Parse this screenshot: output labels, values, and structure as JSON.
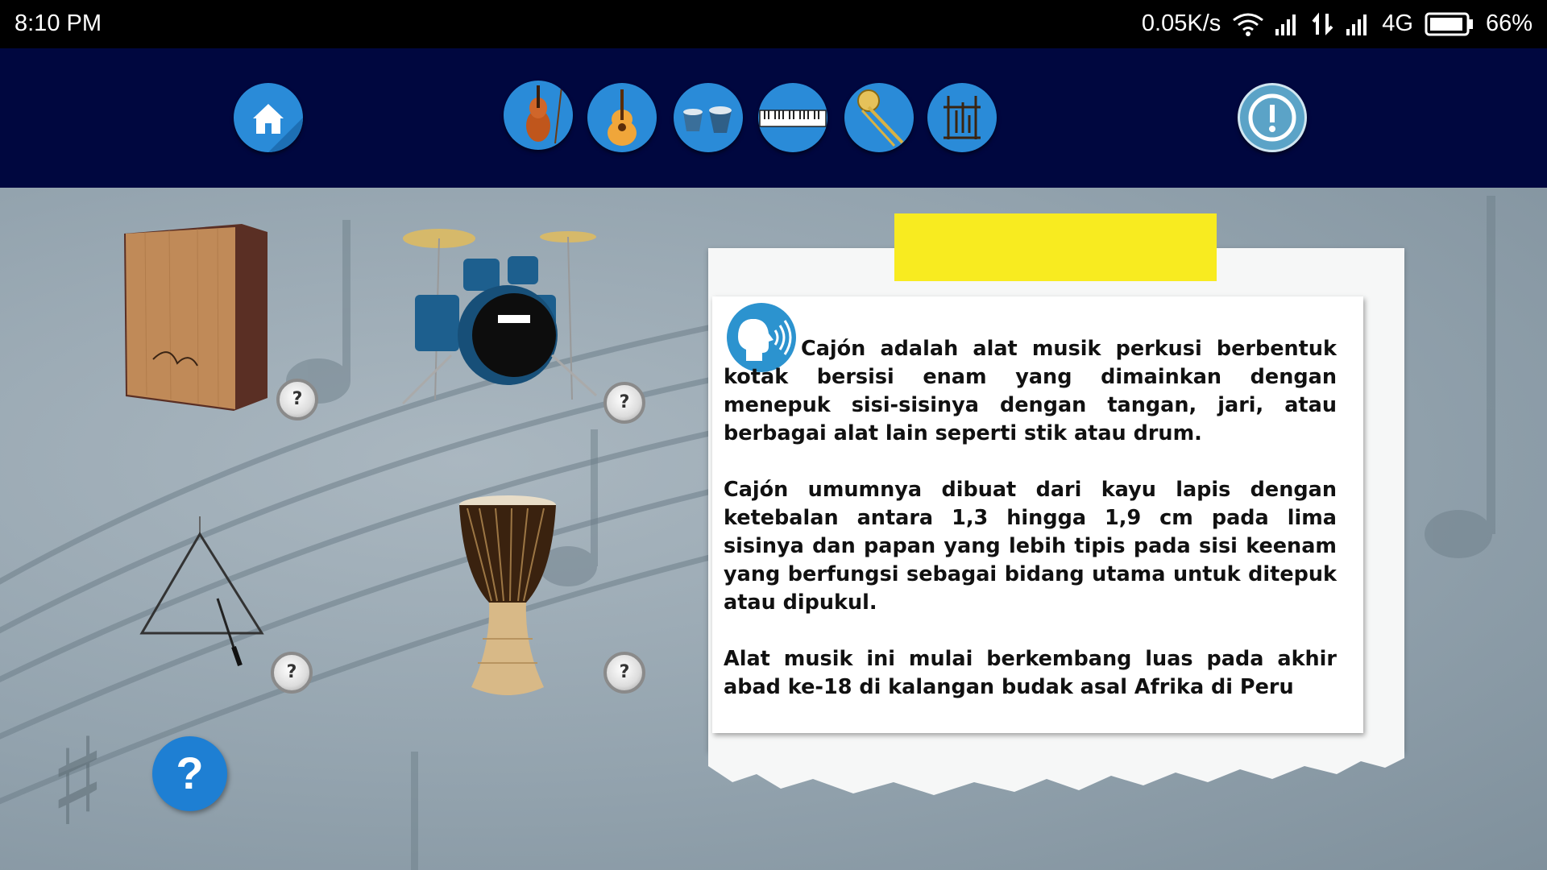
{
  "status_bar": {
    "time": "8:10 PM",
    "net_speed": "0.05K/s",
    "network_type": "4G",
    "battery_percent": "66%",
    "icons": [
      "wifi-icon",
      "signal-icon",
      "data-transfer-icon",
      "signal-icon",
      "battery-icon"
    ]
  },
  "nav": {
    "home_icon": "home-icon",
    "instrument_icons": [
      "violin-icon",
      "guitar-icon",
      "bongo-icon",
      "keyboard-icon",
      "trombone-icon",
      "angklung-icon"
    ],
    "info_icon": "info-icon"
  },
  "instruments": [
    {
      "name": "cajon",
      "help_label": "?"
    },
    {
      "name": "drum-kit",
      "help_label": "?"
    },
    {
      "name": "triangle",
      "help_label": "?"
    },
    {
      "name": "djembe",
      "help_label": "?"
    }
  ],
  "help_button_label": "?",
  "info_card": {
    "audio_icon": "speaker-icon",
    "paragraphs": [
      "Cajón adalah alat musik perkusi berbentuk kotak bersisi enam yang dimainkan dengan menepuk sisi-sisinya dengan tangan, jari, atau berbagai alat lain seperti stik atau  drum.",
      "Cajón umumnya dibuat dari kayu lapis dengan ketebalan antara 1,3 hingga 1,9 cm pada lima sisinya dan papan yang lebih tipis pada sisi keenam yang berfungsi sebagai bidang utama untuk ditepuk atau dipukul.",
      "Alat musik ini mulai berkembang luas pada akhir abad ke-18 di kalangan budak asal Afrika di Peru"
    ]
  },
  "colors": {
    "nav_background": "#00073f",
    "nav_button": "#2a8bd8",
    "tape": "#f8eb20",
    "help_button": "#1e7fd3"
  }
}
